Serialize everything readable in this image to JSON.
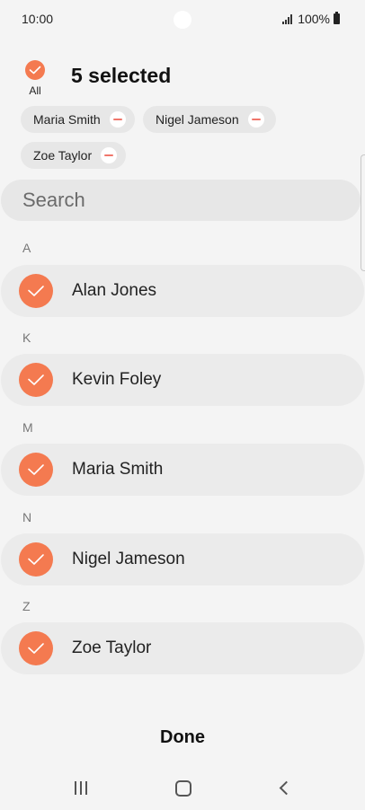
{
  "status_bar": {
    "time": "10:00",
    "battery": "100%",
    "icons": [
      "signal-icon",
      "battery-icon"
    ]
  },
  "header": {
    "all_label": "All",
    "selected_count": "5 selected"
  },
  "chips": [
    {
      "label": "Maria Smith"
    },
    {
      "label": "Nigel Jameson"
    },
    {
      "label": "Zoe Taylor"
    }
  ],
  "search": {
    "placeholder": "Search"
  },
  "sections": [
    {
      "letter": "A",
      "contacts": [
        {
          "name": "Alan Jones",
          "checked": true
        }
      ]
    },
    {
      "letter": "K",
      "contacts": [
        {
          "name": "Kevin Foley",
          "checked": true
        }
      ]
    },
    {
      "letter": "M",
      "contacts": [
        {
          "name": "Maria Smith",
          "checked": true
        }
      ]
    },
    {
      "letter": "N",
      "contacts": [
        {
          "name": "Nigel Jameson",
          "checked": true
        }
      ]
    },
    {
      "letter": "Z",
      "contacts": [
        {
          "name": "Zoe Taylor",
          "checked": true
        }
      ]
    }
  ],
  "footer": {
    "done_label": "Done"
  },
  "colors": {
    "accent": "#f47a50",
    "chip_remove": "#f0766b",
    "background": "#f4f4f4",
    "row": "#ebebeb"
  }
}
